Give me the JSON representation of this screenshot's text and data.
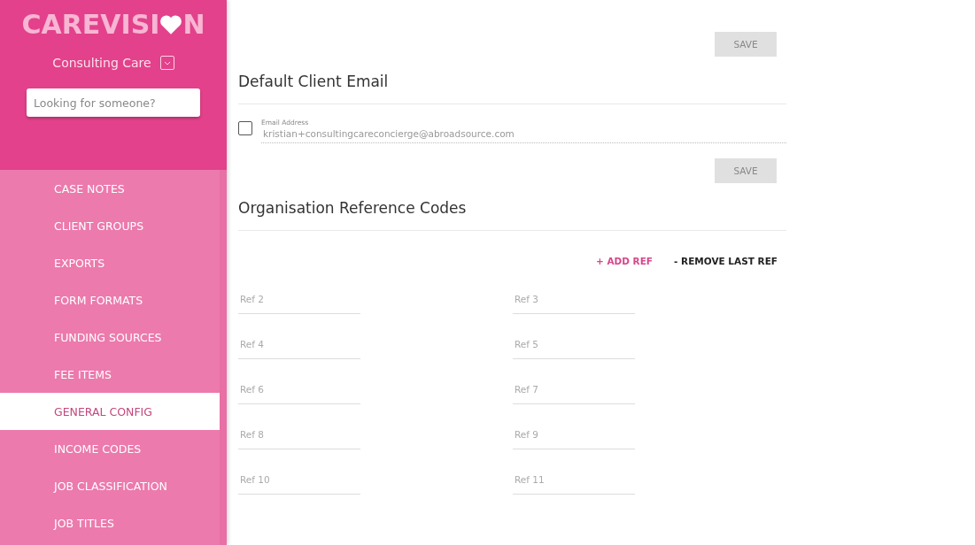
{
  "sidebar": {
    "logo": {
      "before": "CAREVISI",
      "after": "N"
    },
    "organisation": "Consulting Care",
    "search": {
      "placeholder": "Looking for someone?"
    },
    "items": [
      {
        "label": "CASE NOTES",
        "selected": false
      },
      {
        "label": "CLIENT GROUPS",
        "selected": false
      },
      {
        "label": "EXPORTS",
        "selected": false
      },
      {
        "label": "FORM FORMATS",
        "selected": false
      },
      {
        "label": "FUNDING SOURCES",
        "selected": false
      },
      {
        "label": "FEE ITEMS",
        "selected": false
      },
      {
        "label": "GENERAL CONFIG",
        "selected": true
      },
      {
        "label": "INCOME CODES",
        "selected": false
      },
      {
        "label": "JOB CLASSIFICATION",
        "selected": false
      },
      {
        "label": "JOB TITLES",
        "selected": false
      }
    ]
  },
  "top_save": "SAVE",
  "email_section": {
    "title": "Default Client Email",
    "checked": false,
    "field_label": "Email Address",
    "value": "kristian+consultingcareconcierge@abroadsource.com",
    "save": "SAVE"
  },
  "ref_section": {
    "title": "Organisation Reference Codes",
    "add": "+ ADD REF",
    "remove": "- REMOVE LAST REF",
    "fields": [
      {
        "placeholder": "Ref 2"
      },
      {
        "placeholder": "Ref 3"
      },
      {
        "placeholder": "Ref 4"
      },
      {
        "placeholder": "Ref 5"
      },
      {
        "placeholder": "Ref 6"
      },
      {
        "placeholder": "Ref 7"
      },
      {
        "placeholder": "Ref 8"
      },
      {
        "placeholder": "Ref 9"
      },
      {
        "placeholder": "Ref 10"
      },
      {
        "placeholder": "Ref 11"
      }
    ]
  }
}
